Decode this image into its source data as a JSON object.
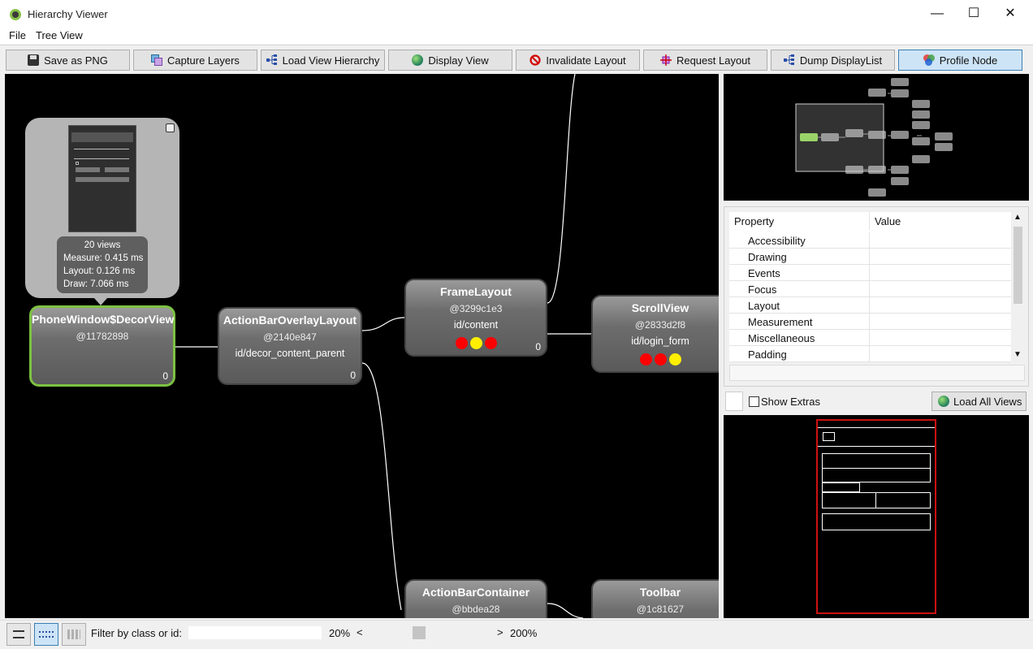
{
  "window": {
    "title": "Hierarchy Viewer",
    "minimize": "—",
    "maximize": "☐",
    "close": "✕"
  },
  "menu": [
    "File",
    "Tree View"
  ],
  "toolbar": [
    {
      "label": "Save as PNG",
      "icon": "floppy-icon"
    },
    {
      "label": "Capture Layers",
      "icon": "layers-icon"
    },
    {
      "label": "Load View Hierarchy",
      "icon": "hierarchy-icon"
    },
    {
      "label": "Display View",
      "icon": "globe-icon"
    },
    {
      "label": "Invalidate Layout",
      "icon": "no-entry-icon"
    },
    {
      "label": "Request Layout",
      "icon": "crosshair-icon"
    },
    {
      "label": "Dump DisplayList",
      "icon": "hierarchy-icon"
    },
    {
      "label": "Profile Node",
      "icon": "venn-icon",
      "active": true
    }
  ],
  "tooltip": {
    "views": "20 views",
    "measure": "Measure: 0.415 ms",
    "layout": "Layout: 0.126 ms",
    "draw": "Draw: 7.066 ms"
  },
  "nodes": [
    {
      "name": "PhoneWindow$DecorView",
      "hash": "@11782898",
      "id": "",
      "count": "0",
      "selected": true
    },
    {
      "name": "ActionBarOverlayLayout",
      "hash": "@2140e847",
      "id": "id/decor_content_parent",
      "count": "0"
    },
    {
      "name": "FrameLayout",
      "hash": "@3299c1e3",
      "id": "id/content",
      "count": "0",
      "dots": [
        "#ff0000",
        "#ffee00",
        "#ff0000"
      ]
    },
    {
      "name": "ScrollView",
      "hash": "@2833d2f8",
      "id": "id/login_form",
      "count": "",
      "dots": [
        "#ff0000",
        "#ff0000",
        "#ffee00"
      ]
    },
    {
      "name": "ActionBarContainer",
      "hash": "@bbdea28",
      "id": "",
      "count": ""
    },
    {
      "name": "Toolbar",
      "hash": "@1c81627",
      "id": "",
      "count": ""
    }
  ],
  "properties": {
    "header_property": "Property",
    "header_value": "Value",
    "rows": [
      "Accessibility",
      "Drawing",
      "Events",
      "Focus",
      "Layout",
      "Measurement",
      "Miscellaneous",
      "Padding"
    ]
  },
  "extras": {
    "show_extras": "Show Extras",
    "load_all_views": "Load All Views"
  },
  "statusbar": {
    "filter_label": "Filter by class or id:",
    "filter_value": "",
    "zoom_min": "20%",
    "zoom_max": "200%",
    "zoom_left": "<",
    "zoom_right": ">",
    "zoom_level": 0.4
  },
  "colors": {
    "selected_border": "#7dc242",
    "accent_blue": "#3c7fb1",
    "preview_red": "#cc1111"
  }
}
